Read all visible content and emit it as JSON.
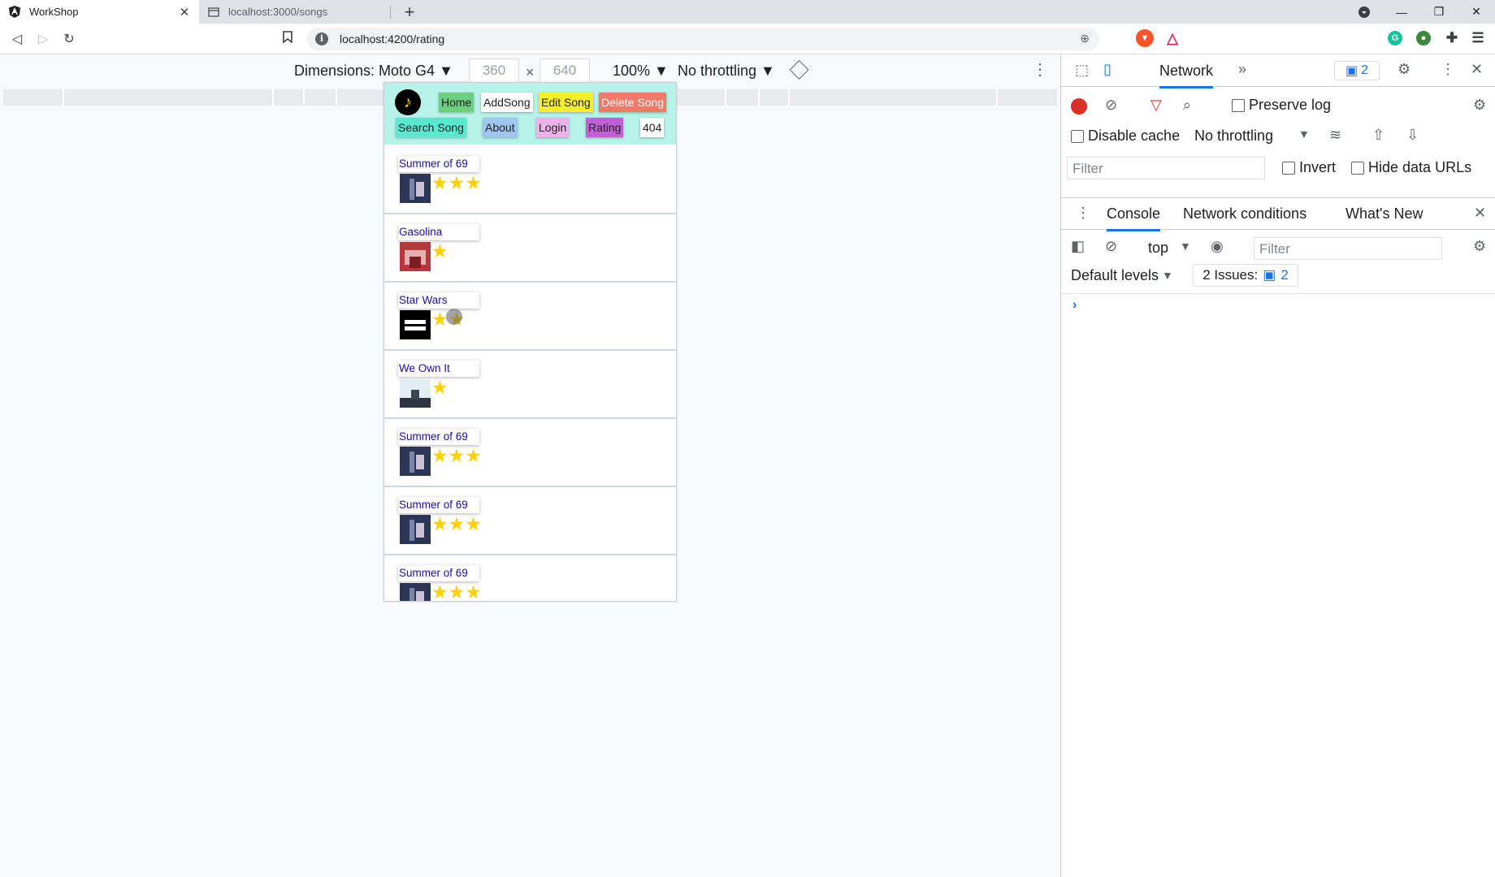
{
  "tabs": [
    {
      "title": "WorkShop",
      "close": "✕"
    },
    {
      "title": "localhost:3000/songs"
    }
  ],
  "new_tab": "+",
  "address": {
    "url": "localhost:4200/rating"
  },
  "device_toolbar": {
    "dimensions_label": "Dimensions: Moto G4 ▼",
    "width": "360",
    "height": "640",
    "times": "×",
    "zoom": "100% ▼",
    "throttling": "No throttling ▼"
  },
  "app": {
    "logo": "♪",
    "nav": {
      "home": "Home",
      "add_song": "AddSong",
      "edit_song": "Edit Song",
      "delete_song": "Delete Song",
      "search_song": "Search Song",
      "about": "About",
      "login": "Login",
      "rating": "Rating",
      "not_found": "404"
    },
    "colors": {
      "nav_bg": "#b8f3ea",
      "home": "#6ccf7f",
      "add_song": "#ffffff",
      "edit_song": "#f5ef2a",
      "delete_song": "#f07a6a",
      "search_song": "#5ae8d0",
      "about": "#9fc6f0",
      "login": "#eeb1ea",
      "rating": "#c35fd6",
      "star": "#ffd000"
    },
    "songs": [
      {
        "title": "Summer of 69",
        "stars": "★★★",
        "rating": 3
      },
      {
        "title": "Gasolina",
        "stars": "★",
        "rating": 1
      },
      {
        "title": "Star Wars",
        "stars": "★★",
        "rating": 2
      },
      {
        "title": "We Own It",
        "stars": "★",
        "rating": 1
      },
      {
        "title": "Summer of 69",
        "stars": "★★★",
        "rating": 3
      },
      {
        "title": "Summer of 69",
        "stars": "★★★",
        "rating": 3
      },
      {
        "title": "Summer of 69",
        "stars": "★★★",
        "rating": 3
      }
    ]
  },
  "devtools": {
    "main_tab": "Network",
    "more_tabs": "»",
    "issues_badge": "2",
    "preserve_log": "Preserve log",
    "disable_cache": "Disable cache",
    "throttling": "No throttling",
    "filter_placeholder": "Filter",
    "invert": "Invert",
    "hide_data_urls": "Hide data URLs",
    "drawer_tabs": [
      "Console",
      "Network conditions",
      "What's New"
    ],
    "context": "top",
    "console_filter_placeholder": "Filter",
    "levels": "Default levels",
    "issues_label": "2 Issues:",
    "issues_count": "2",
    "prompt": "›"
  }
}
